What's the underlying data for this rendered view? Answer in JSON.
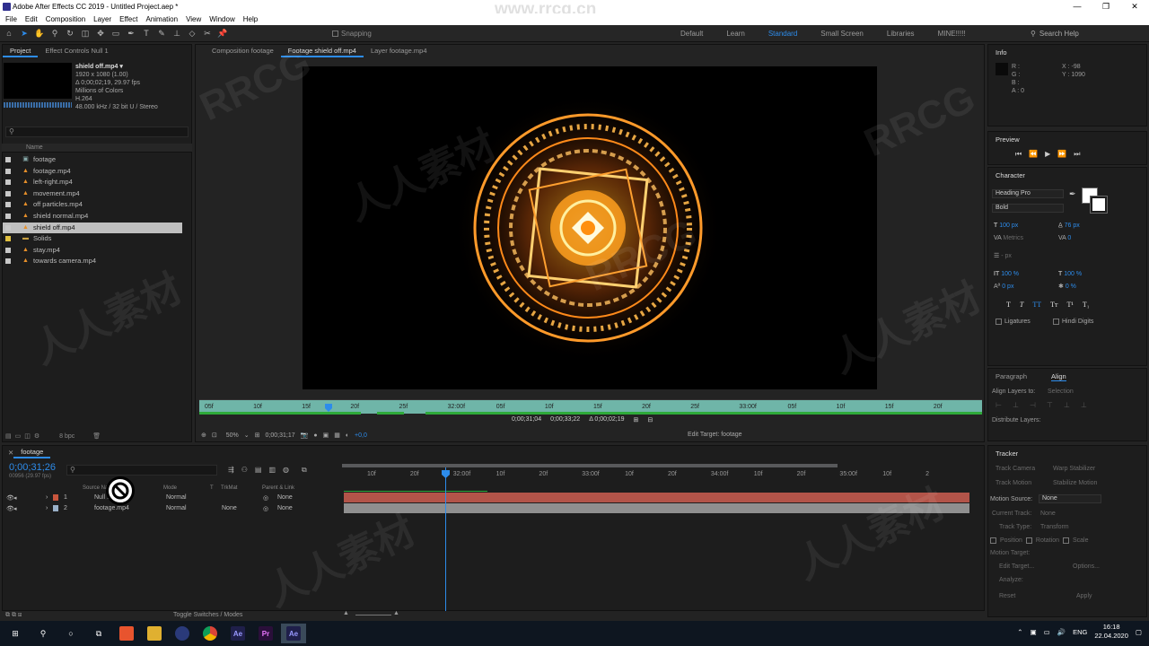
{
  "titlebar": {
    "title": "Adobe After Effects CC 2019 - Untitled Project.aep *",
    "watermark": "www.rrcg.cn"
  },
  "menu": [
    "File",
    "Edit",
    "Composition",
    "Layer",
    "Effect",
    "Animation",
    "View",
    "Window",
    "Help"
  ],
  "toolbar": {
    "snapping": "Snapping"
  },
  "workspaces": [
    "Default",
    "Learn",
    "Standard",
    "Small Screen",
    "Libraries",
    "MINE!!!!!"
  ],
  "workspace_active": "Standard",
  "search_help": "Search Help",
  "project": {
    "tab": "Project",
    "tab2": "Effect Controls Null 1",
    "selected_name": "shield off.mp4 ▾",
    "info": [
      "1920 x 1080 (1.00)",
      "Δ 0;00;02;19, 29.97 fps",
      "Millions of Colors",
      "H.264",
      "48.000 kHz / 32 bit U / Stereo"
    ],
    "search_placeholder": "",
    "col_name": "Name",
    "items": [
      {
        "name": "footage",
        "type": "comp",
        "color": "#c8c8c8"
      },
      {
        "name": "footage.mp4",
        "type": "video",
        "color": "#c8c8c8"
      },
      {
        "name": "left-right.mp4",
        "type": "video",
        "color": "#c8c8c8"
      },
      {
        "name": "movement.mp4",
        "type": "video",
        "color": "#c8c8c8"
      },
      {
        "name": "off particles.mp4",
        "type": "video",
        "color": "#c8c8c8"
      },
      {
        "name": "shield normal.mp4",
        "type": "video",
        "color": "#c8c8c8"
      },
      {
        "name": "shield off.mp4",
        "type": "video",
        "color": "#c8c8c8",
        "selected": true
      },
      {
        "name": "Solids",
        "type": "folder",
        "color": "#e0c040"
      },
      {
        "name": "stay.mp4",
        "type": "video",
        "color": "#c8c8c8"
      },
      {
        "name": "towards camera.mp4",
        "type": "video",
        "color": "#c8c8c8"
      }
    ],
    "bpc": "8 bpc"
  },
  "viewer": {
    "tabs": [
      "Composition footage",
      "Footage shield off.mp4",
      "Layer footage.mp4"
    ],
    "ruler_labels": [
      "05f",
      "10f",
      "15f",
      "20f",
      "25f",
      "32:00f",
      "05f",
      "10f",
      "15f",
      "20f",
      "25f",
      "33:00f",
      "05f",
      "10f",
      "15f",
      "20f"
    ],
    "in_point": "0;00;31;04",
    "out_point": "0;00;33;22",
    "duration": "Δ 0;00;02;19",
    "zoom": "50%",
    "timecode": "0;00;31;17",
    "exposure": "+0,0",
    "edit_target": "Edit Target: footage"
  },
  "info_panel": {
    "title": "Info",
    "rgb": [
      "R :",
      "G :",
      "B :",
      "A : 0"
    ],
    "x": "X : -98",
    "y": "Y : 1090"
  },
  "preview_panel": {
    "title": "Preview"
  },
  "character": {
    "title": "Character",
    "font": "Heading Pro",
    "style": "Bold",
    "size": "100 px",
    "leading": "76 px",
    "kerning": "Metrics",
    "tracking": "0",
    "stroke": "- px",
    "vscale": "100 %",
    "hscale": "100 %",
    "baseline": "0 px",
    "tsume": "0 %",
    "ligatures": "Ligatures",
    "hindi": "Hindi Digits"
  },
  "align_panel": {
    "tab1": "Paragraph",
    "tab2": "Align",
    "align_to_label": "Align Layers to:",
    "align_to": "Selection",
    "distribute": "Distribute Layers:"
  },
  "tracker": {
    "title": "Tracker",
    "track_camera": "Track Camera",
    "warp_stabilizer": "Warp Stabilizer",
    "track_motion": "Track Motion",
    "stabilize_motion": "Stabilize Motion",
    "motion_source_label": "Motion Source:",
    "motion_source": "None",
    "current_track_label": "Current Track:",
    "current_track": "None",
    "track_type_label": "Track Type:",
    "track_type": "Transform",
    "position": "Position",
    "rotation": "Rotation",
    "scale": "Scale",
    "motion_target": "Motion Target:",
    "edit_target": "Edit Target...",
    "options": "Options...",
    "analyze": "Analyze:",
    "reset": "Reset",
    "apply": "Apply"
  },
  "timeline": {
    "tab": "footage",
    "timecode": "0;00;31;26",
    "fps": "00956 (29.97 fps)",
    "headers": {
      "source": "Source Name",
      "mode": "Mode",
      "t": "T",
      "trkmat": "TrkMat",
      "parent": "Parent & Link"
    },
    "layers": [
      {
        "num": "1",
        "name": "Null 1",
        "mode": "Normal",
        "trkmat": "",
        "parent": "None",
        "label": "#c8553d"
      },
      {
        "num": "2",
        "name": "footage.mp4",
        "mode": "Normal",
        "trkmat": "None",
        "parent": "None",
        "label": "#9ab0c8"
      }
    ],
    "ruler": [
      "10f",
      "20f",
      "32:00f",
      "10f",
      "20f",
      "33:00f",
      "10f",
      "20f",
      "34:00f",
      "10f",
      "20f",
      "35:00f",
      "10f",
      "2"
    ],
    "toggle": "Toggle Switches / Modes"
  },
  "taskbar": {
    "apps": [
      "Ae",
      "Pr",
      "Ae"
    ],
    "lang": "ENG",
    "time": "16:18",
    "date": "22.04.2020"
  },
  "watermarks": [
    "RRCG",
    "人人素材"
  ]
}
